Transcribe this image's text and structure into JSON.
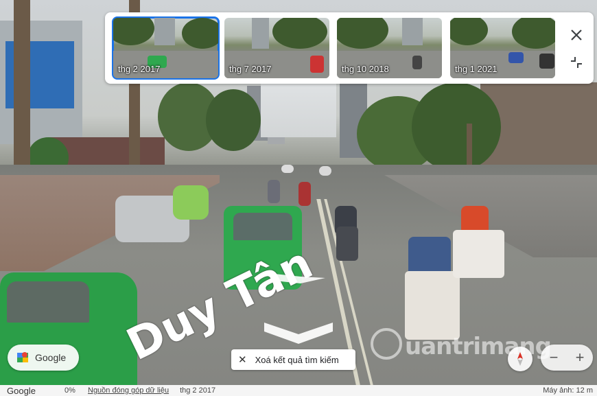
{
  "timeline": {
    "items": [
      {
        "label": "thg 2 2017",
        "selected": true
      },
      {
        "label": "thg 7 2017",
        "selected": false
      },
      {
        "label": "thg 10 2018",
        "selected": false
      },
      {
        "label": "thg 1 2021",
        "selected": false
      }
    ],
    "close_icon": "close-icon",
    "collapse_icon": "collapse-icon"
  },
  "scene": {
    "road_text": "Duy Tân",
    "watermark": "uantrimang"
  },
  "controls": {
    "google_label": "Google",
    "clear_label": "Xoá kết quả tìm kiếm",
    "zoom_out": "−",
    "zoom_in": "+"
  },
  "footer": {
    "google": "Google",
    "percent": "0%",
    "source": "Nguồn đóng góp dữ liệu",
    "date": "thg 2 2017",
    "scale": "Máy ảnh: 12 m"
  },
  "colors": {
    "accent": "#1a73e8",
    "taxi_green": "#2fa84f"
  }
}
